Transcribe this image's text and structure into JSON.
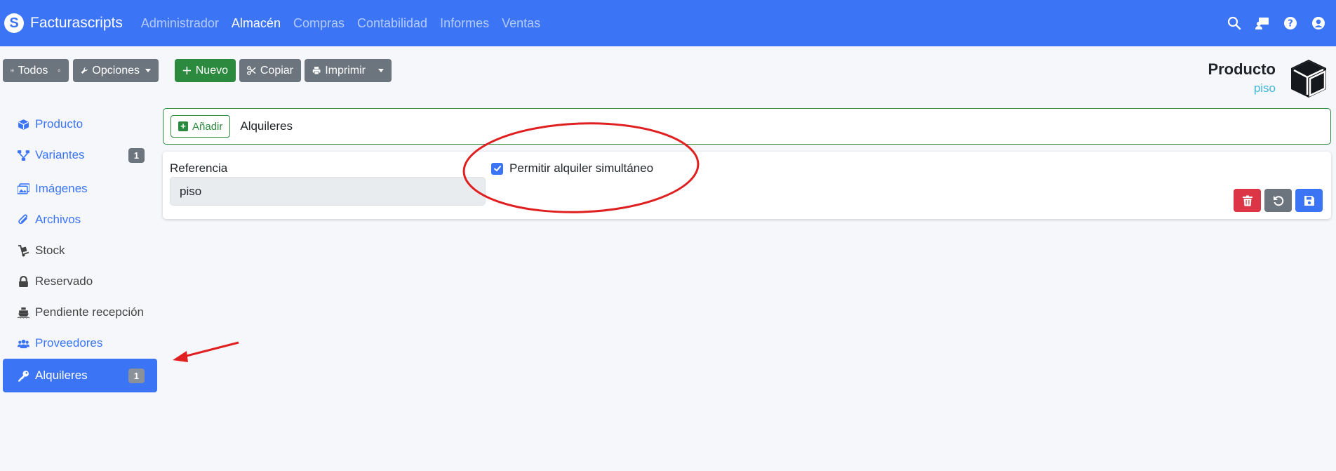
{
  "navbar": {
    "brand": "Facturascripts",
    "menu": [
      {
        "label": "Administrador",
        "active": false
      },
      {
        "label": "Almacén",
        "active": true
      },
      {
        "label": "Compras",
        "active": false
      },
      {
        "label": "Contabilidad",
        "active": false
      },
      {
        "label": "Informes",
        "active": false
      },
      {
        "label": "Ventas",
        "active": false
      }
    ],
    "icons": [
      "search-icon",
      "chalkboard-user-icon",
      "question-icon",
      "user-circle-icon"
    ]
  },
  "toolbar": {
    "todos": "Todos",
    "opciones": "Opciones",
    "nuevo": "Nuevo",
    "copiar": "Copiar",
    "imprimir": "Imprimir"
  },
  "header": {
    "title": "Producto",
    "subtitle": "piso"
  },
  "sidebar": {
    "items": [
      {
        "label": "Producto",
        "icon": "cube-icon"
      },
      {
        "label": "Variantes",
        "icon": "sitemap-icon",
        "badge": "1"
      },
      {
        "label": "Imágenes",
        "icon": "images-icon"
      },
      {
        "label": "Archivos",
        "icon": "paperclip-icon"
      },
      {
        "label": "Stock",
        "icon": "dolly-icon"
      },
      {
        "label": "Reservado",
        "icon": "lock-icon"
      },
      {
        "label": "Pendiente recepción",
        "icon": "ship-icon"
      },
      {
        "label": "Proveedores",
        "icon": "users-icon"
      },
      {
        "label": "Alquileres",
        "icon": "key-icon",
        "badge": "1",
        "active": true
      }
    ]
  },
  "main": {
    "add_label": "Añadir",
    "section_title": "Alquileres",
    "form": {
      "referencia_label": "Referencia",
      "referencia_value": "piso",
      "checkbox_label": "Permitir alquiler simultáneo",
      "checkbox_checked": true
    }
  },
  "colors": {
    "primary": "#3b74f5",
    "success": "#2b8a3e",
    "danger": "#dc3545",
    "secondary": "#6c757d",
    "annotation": "#e02020"
  }
}
